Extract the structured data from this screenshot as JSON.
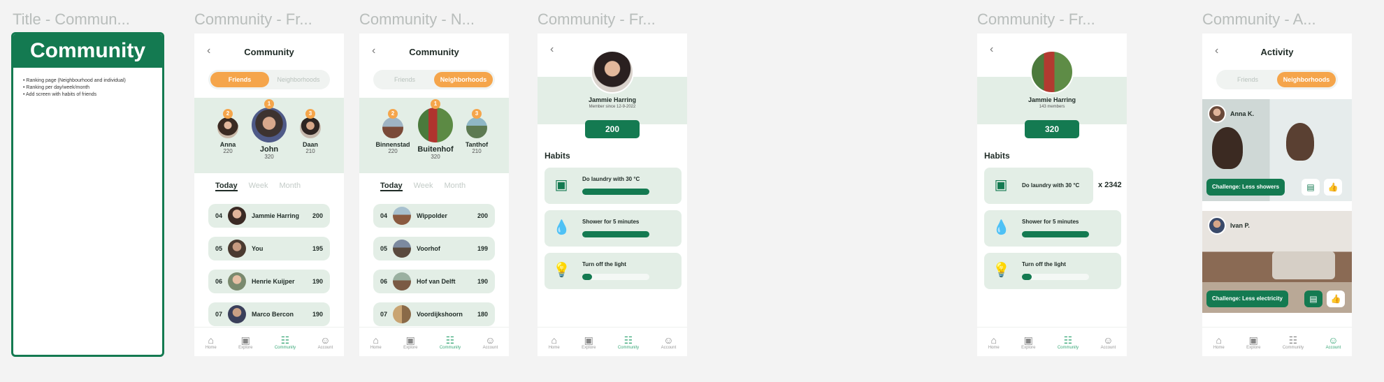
{
  "frame_titles": [
    "Title - Commun...",
    "Community - Fr...",
    "Community - N...",
    "Community - Fr...",
    "Community - Fr...",
    "Community - A..."
  ],
  "title_card": {
    "heading": "Community",
    "bullets": [
      "Ranking page (Neighbourhood and individual)",
      "Ranking per day/week/month",
      "Add screen with habits of friends"
    ]
  },
  "common": {
    "back_glyph": "‹",
    "nav": [
      {
        "label": "Home",
        "icon": "home-icon"
      },
      {
        "label": "Explore",
        "icon": "explore-icon"
      },
      {
        "label": "Community",
        "icon": "community-icon"
      },
      {
        "label": "Account",
        "icon": "account-icon"
      }
    ],
    "period_tabs": [
      "Today",
      "Week",
      "Month"
    ],
    "segment": [
      "Friends",
      "Neighborhoods"
    ],
    "habits_heading": "Habits"
  },
  "friends_screen": {
    "title": "Community",
    "podium": [
      {
        "medal": "2",
        "name": "Anna",
        "points": "220"
      },
      {
        "medal": "1",
        "name": "John",
        "points": "320"
      },
      {
        "medal": "3",
        "name": "Daan",
        "points": "210"
      }
    ],
    "ranking": [
      {
        "pos": "04",
        "name": "Jammie Harring",
        "points": "200"
      },
      {
        "pos": "05",
        "name": "You",
        "points": "195"
      },
      {
        "pos": "06",
        "name": "Henrie Kuijper",
        "points": "190"
      },
      {
        "pos": "07",
        "name": "Marco Bercon",
        "points": "190"
      }
    ]
  },
  "neighborhood_screen": {
    "title": "Community",
    "podium": [
      {
        "medal": "2",
        "name": "Binnenstad",
        "points": "220"
      },
      {
        "medal": "1",
        "name": "Buitenhof",
        "points": "320"
      },
      {
        "medal": "3",
        "name": "Tanthof",
        "points": "210"
      }
    ],
    "ranking": [
      {
        "pos": "04",
        "name": "Wippolder",
        "points": "200"
      },
      {
        "pos": "05",
        "name": "Voorhof",
        "points": "199"
      },
      {
        "pos": "06",
        "name": "Hof van Delft",
        "points": "190"
      },
      {
        "pos": "07",
        "name": "Voordijkshoorn",
        "points": "180"
      }
    ]
  },
  "friend_profile": {
    "name": "Jammie Harring",
    "subtitle": "Member since 12-9-2022",
    "score": "200",
    "habits": [
      {
        "name": "Do laundry with 30 °C",
        "icon": "washing-machine-icon",
        "progress": 1.0
      },
      {
        "name": "Shower for 5 minutes",
        "icon": "water-drop-icon",
        "progress": 1.0
      },
      {
        "name": "Turn off the light",
        "icon": "lightbulb-icon",
        "progress": 0.15
      }
    ]
  },
  "neighborhood_profile": {
    "name": "Jammie Harring",
    "subtitle": "143 members",
    "score": "320",
    "habits": [
      {
        "name": "Do laundry with 30 °C",
        "icon": "washing-machine-icon",
        "progress": 1.0
      },
      {
        "name": "Shower for 5 minutes",
        "icon": "water-drop-icon",
        "progress": 1.0
      },
      {
        "name": "Turn off the light",
        "icon": "lightbulb-icon",
        "progress": 0.15
      }
    ],
    "multiplier": "x 2342"
  },
  "activity_screen": {
    "title": "Activity",
    "posts": [
      {
        "user": "Anna K.",
        "challenge": "Challenge: Less showers"
      },
      {
        "user": "Ivan P.",
        "challenge": "Challenge: Less electricity"
      }
    ]
  },
  "colors": {
    "primary": "#147a51",
    "accent": "#f5a54b",
    "tint": "#e3eee6"
  }
}
